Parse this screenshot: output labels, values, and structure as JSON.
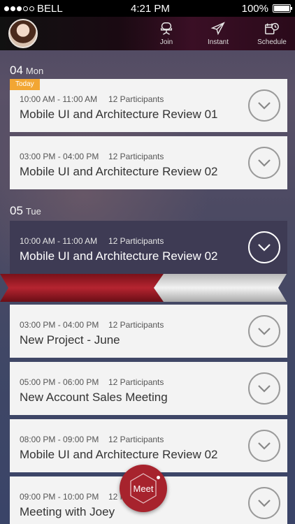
{
  "status": {
    "carrier": "BELL",
    "time": "4:21 PM",
    "battery": "100%",
    "battery_level": 1.0
  },
  "nav": {
    "join_label": "Join",
    "instant_label": "Instant",
    "schedule_label": "Schedule"
  },
  "days": [
    {
      "num": "04",
      "dow": "Mon"
    },
    {
      "num": "05",
      "dow": "Tue"
    }
  ],
  "today_badge": "Today",
  "meetings": [
    {
      "time": "10:00 AM - 11:00 AM",
      "participants": "12 Participants",
      "title": "Mobile UI and Architecture Review 01"
    },
    {
      "time": "03:00 PM - 04:00 PM",
      "participants": "12 Participants",
      "title": "Mobile UI and Architecture Review 02"
    },
    {
      "time": "10:00 AM - 11:00 AM",
      "participants": "12 Participants",
      "title": "Mobile UI and Architecture Review 02"
    },
    {
      "time": "03:00 PM - 04:00 PM",
      "participants": "12 Participants",
      "title": "New Project - June"
    },
    {
      "time": "05:00 PM - 06:00 PM",
      "participants": "12 Participants",
      "title": "New Account Sales Meeting"
    },
    {
      "time": "08:00 PM - 09:00 PM",
      "participants": "12 Participants",
      "title": "Mobile UI and Architecture Review 02"
    },
    {
      "time": "09:00 PM - 10:00 PM",
      "participants": "12 Participants",
      "title": "Meeting with Joey"
    }
  ],
  "meet_button": "Meet",
  "colors": {
    "accent": "#a7232d",
    "today": "#f2a633",
    "active_card": "#3e3b54"
  }
}
